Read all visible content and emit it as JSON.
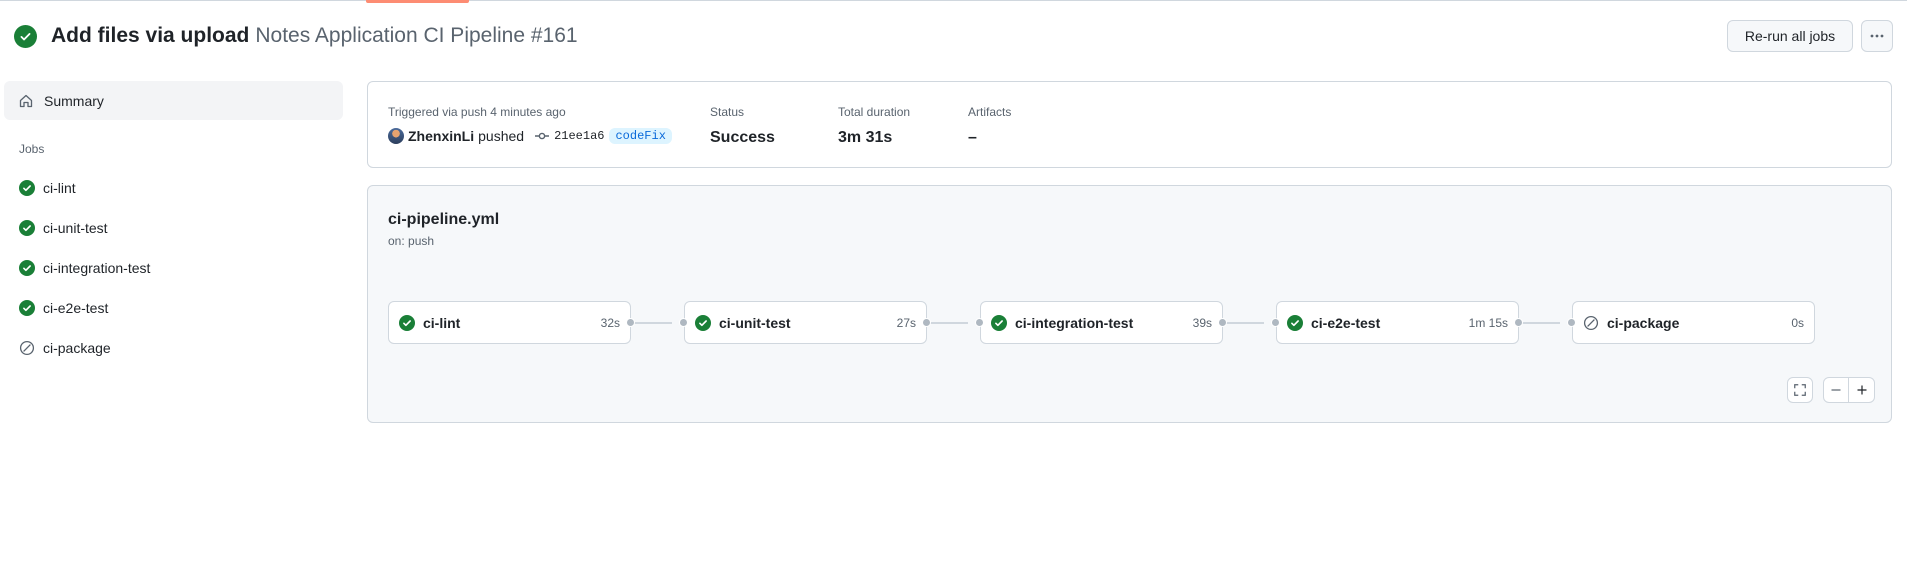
{
  "header": {
    "title": "Add files via upload",
    "subtitle": "Notes Application CI Pipeline #161",
    "rerun_label": "Re-run all jobs",
    "more_label": "···"
  },
  "sidebar": {
    "summary_label": "Summary",
    "jobs_heading": "Jobs",
    "jobs": [
      {
        "label": "ci-lint",
        "status": "success"
      },
      {
        "label": "ci-unit-test",
        "status": "success"
      },
      {
        "label": "ci-integration-test",
        "status": "success"
      },
      {
        "label": "ci-e2e-test",
        "status": "success"
      },
      {
        "label": "ci-package",
        "status": "skipped"
      }
    ]
  },
  "run_info": {
    "trigger_label": "Triggered via push 4 minutes ago",
    "user": "ZhenxinLi",
    "action": "pushed",
    "commit_sha": "21ee1a6",
    "branch": "codeFix",
    "status_label": "Status",
    "status_value": "Success",
    "duration_label": "Total duration",
    "duration_value": "3m 31s",
    "artifacts_label": "Artifacts",
    "artifacts_value": "–"
  },
  "workflow": {
    "file": "ci-pipeline.yml",
    "trigger": "on: push",
    "nodes": [
      {
        "label": "ci-lint",
        "duration": "32s",
        "status": "success"
      },
      {
        "label": "ci-unit-test",
        "duration": "27s",
        "status": "success"
      },
      {
        "label": "ci-integration-test",
        "duration": "39s",
        "status": "success"
      },
      {
        "label": "ci-e2e-test",
        "duration": "1m 15s",
        "status": "success"
      },
      {
        "label": "ci-package",
        "duration": "0s",
        "status": "skipped"
      }
    ]
  },
  "colors": {
    "success": "#1a7f37",
    "accent": "#fd8c73",
    "link": "#0969da",
    "muted": "#59636e",
    "border": "#d0d7de"
  },
  "icons": {
    "status_success": "check-circle-icon",
    "status_skipped": "skip-icon",
    "summary": "home-icon",
    "commit": "git-commit-icon",
    "fullscreen": "fullscreen-icon",
    "zoom_out": "minus-icon",
    "zoom_in": "plus-icon"
  }
}
